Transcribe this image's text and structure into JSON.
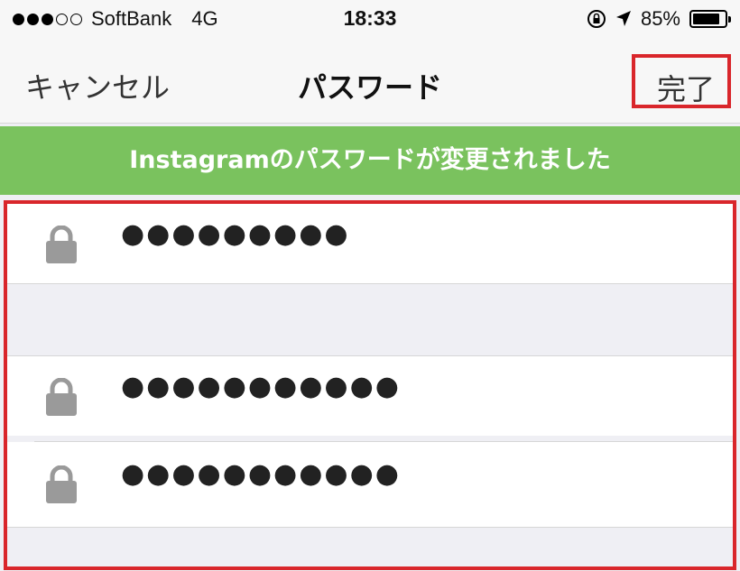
{
  "status_bar": {
    "carrier": "SoftBank",
    "network": "4G",
    "time": "18:33",
    "battery_percent": "85%",
    "battery_level": 0.85,
    "signal_bars_on": 3,
    "signal_bars_total": 5
  },
  "nav": {
    "cancel_label": "キャンセル",
    "title": "パスワード",
    "done_label": "完了"
  },
  "banner": {
    "message": "Instagramのパスワードが変更されました"
  },
  "passwords": [
    {
      "dots": "●●●●●●●●●",
      "icon": "lock-icon"
    },
    {
      "dots": "●●●●●●●●●●●",
      "icon": "lock-icon"
    },
    {
      "dots": "●●●●●●●●●●●",
      "icon": "lock-icon"
    }
  ],
  "colors": {
    "banner_green": "#7ac25e",
    "highlight_red": "#d9262b",
    "lock_gray": "#9a9a9a"
  }
}
